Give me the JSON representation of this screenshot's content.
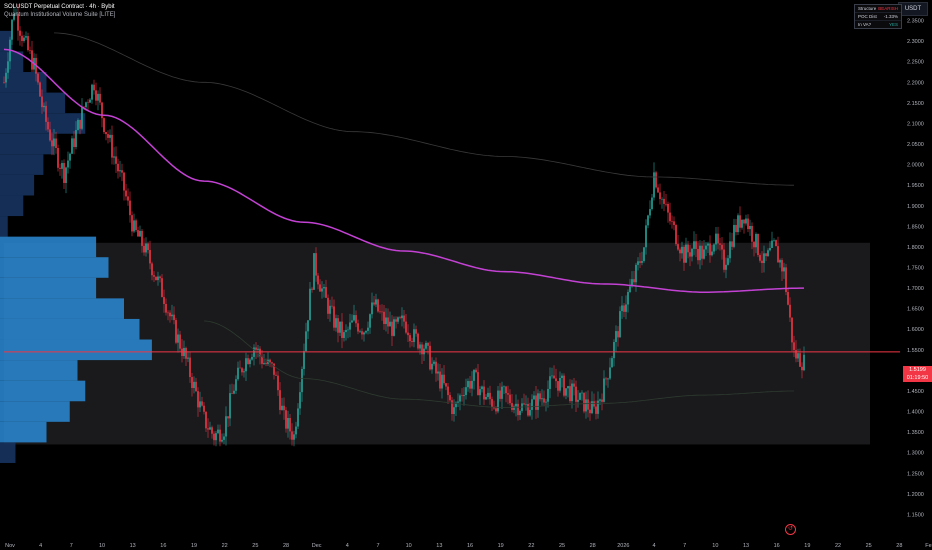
{
  "legend": {
    "symbol": "SOLUSDT Perpetual Contract · 4h · Bybit",
    "indicator": "Quantum Institutional Volume Suite [LITE]"
  },
  "currency": "USDT",
  "info_table": [
    {
      "key": "Structure",
      "value": "BEARISH",
      "tone": "neg"
    },
    {
      "key": "POC Dist",
      "value": "-1.33%",
      "tone": "neutral"
    },
    {
      "key": "In VA?",
      "value": "YES",
      "tone": "pos"
    }
  ],
  "last_price": {
    "value": "1.5199",
    "countdown": "01:19:50"
  },
  "colors": {
    "up": "#26a69a",
    "down": "#f23645",
    "ma": "#c342d4",
    "profile": "#2a8bd6",
    "profile_dark": "#16335e",
    "poc": "#f23645"
  },
  "icons": {
    "undo": "undo-icon"
  },
  "chart_data": {
    "type": "candlestick",
    "yaxis": {
      "min": 1.1,
      "max": 2.4,
      "ticks": [
        2.35,
        2.3,
        2.25,
        2.2,
        2.15,
        2.1,
        2.05,
        2.0,
        1.95,
        1.9,
        1.85,
        1.8,
        1.75,
        1.7,
        1.65,
        1.6,
        1.55,
        1.5,
        1.45,
        1.4,
        1.35,
        1.3,
        1.25,
        1.2,
        1.15
      ]
    },
    "xaxis": {
      "labels": [
        "Nov",
        "4",
        "7",
        "10",
        "13",
        "16",
        "19",
        "22",
        "25",
        "28",
        "Dec",
        "4",
        "7",
        "10",
        "13",
        "16",
        "19",
        "22",
        "25",
        "28",
        "2026",
        "4",
        "7",
        "10",
        "13",
        "16",
        "19",
        "22",
        "25",
        "28",
        "Feb"
      ]
    },
    "price_path": [
      [
        0,
        2.2
      ],
      [
        2,
        2.38
      ],
      [
        4,
        2.3
      ],
      [
        6,
        2.24
      ],
      [
        8,
        2.12
      ],
      [
        10,
        2.04
      ],
      [
        12,
        1.98
      ],
      [
        14,
        2.06
      ],
      [
        16,
        2.14
      ],
      [
        18,
        2.2
      ],
      [
        20,
        2.1
      ],
      [
        22,
        2.02
      ],
      [
        24,
        1.94
      ],
      [
        26,
        1.84
      ],
      [
        28,
        1.8
      ],
      [
        30,
        1.74
      ],
      [
        32,
        1.68
      ],
      [
        34,
        1.6
      ],
      [
        36,
        1.54
      ],
      [
        38,
        1.46
      ],
      [
        40,
        1.38
      ],
      [
        42,
        1.34
      ],
      [
        44,
        1.36
      ],
      [
        46,
        1.46
      ],
      [
        48,
        1.52
      ],
      [
        50,
        1.56
      ],
      [
        52,
        1.52
      ],
      [
        54,
        1.5
      ],
      [
        56,
        1.38
      ],
      [
        58,
        1.34
      ],
      [
        60,
        1.56
      ],
      [
        62,
        1.76
      ],
      [
        64,
        1.68
      ],
      [
        66,
        1.62
      ],
      [
        68,
        1.58
      ],
      [
        70,
        1.62
      ],
      [
        72,
        1.6
      ],
      [
        74,
        1.66
      ],
      [
        76,
        1.62
      ],
      [
        78,
        1.6
      ],
      [
        80,
        1.62
      ],
      [
        82,
        1.58
      ],
      [
        84,
        1.56
      ],
      [
        86,
        1.5
      ],
      [
        88,
        1.46
      ],
      [
        90,
        1.4
      ],
      [
        92,
        1.46
      ],
      [
        94,
        1.48
      ],
      [
        96,
        1.44
      ],
      [
        98,
        1.42
      ],
      [
        100,
        1.44
      ],
      [
        102,
        1.42
      ],
      [
        104,
        1.41
      ],
      [
        106,
        1.42
      ],
      [
        108,
        1.44
      ],
      [
        110,
        1.48
      ],
      [
        112,
        1.46
      ],
      [
        114,
        1.44
      ],
      [
        116,
        1.42
      ],
      [
        118,
        1.4
      ],
      [
        120,
        1.46
      ],
      [
        122,
        1.56
      ],
      [
        124,
        1.66
      ],
      [
        126,
        1.72
      ],
      [
        128,
        1.8
      ],
      [
        130,
        1.98
      ],
      [
        132,
        1.9
      ],
      [
        134,
        1.84
      ],
      [
        136,
        1.78
      ],
      [
        138,
        1.8
      ],
      [
        140,
        1.78
      ],
      [
        142,
        1.82
      ],
      [
        144,
        1.76
      ],
      [
        146,
        1.84
      ],
      [
        148,
        1.88
      ],
      [
        150,
        1.82
      ],
      [
        152,
        1.76
      ],
      [
        154,
        1.8
      ],
      [
        156,
        1.74
      ],
      [
        158,
        1.54
      ],
      [
        160,
        1.52
      ]
    ],
    "moving_average": [
      [
        0,
        2.28
      ],
      [
        20,
        2.12
      ],
      [
        40,
        1.96
      ],
      [
        60,
        1.86
      ],
      [
        80,
        1.79
      ],
      [
        100,
        1.74
      ],
      [
        120,
        1.71
      ],
      [
        140,
        1.69
      ],
      [
        160,
        1.7
      ]
    ],
    "upper_band": [
      [
        10,
        2.32
      ],
      [
        40,
        2.2
      ],
      [
        70,
        2.08
      ],
      [
        100,
        2.02
      ],
      [
        130,
        1.97
      ],
      [
        158,
        1.95
      ]
    ],
    "lower_band": [
      [
        40,
        1.62
      ],
      [
        60,
        1.48
      ],
      [
        80,
        1.43
      ],
      [
        100,
        1.41
      ],
      [
        120,
        1.42
      ],
      [
        140,
        1.44
      ],
      [
        158,
        1.45
      ]
    ],
    "value_area": {
      "high": 1.81,
      "low": 1.32
    },
    "poc": 1.545,
    "volume_profile": [
      [
        2.3,
        0.08
      ],
      [
        2.25,
        0.15
      ],
      [
        2.2,
        0.3
      ],
      [
        2.15,
        0.42
      ],
      [
        2.1,
        0.55
      ],
      [
        2.05,
        0.35
      ],
      [
        2.0,
        0.28
      ],
      [
        1.95,
        0.22
      ],
      [
        1.9,
        0.15
      ],
      [
        1.85,
        0.05
      ],
      [
        1.8,
        0.62
      ],
      [
        1.75,
        0.7
      ],
      [
        1.7,
        0.62
      ],
      [
        1.65,
        0.8
      ],
      [
        1.6,
        0.9
      ],
      [
        1.55,
        0.98
      ],
      [
        1.5,
        0.5
      ],
      [
        1.45,
        0.55
      ],
      [
        1.4,
        0.45
      ],
      [
        1.35,
        0.3
      ],
      [
        1.3,
        0.1
      ]
    ]
  }
}
